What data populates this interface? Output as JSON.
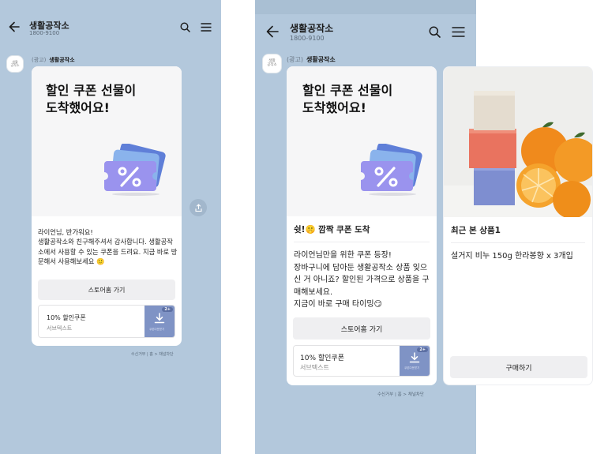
{
  "small_screen": {
    "header": {
      "title": "생활공작소",
      "subtitle": "1800-9100",
      "back_icon": "arrow-left-icon",
      "search_icon": "search-icon",
      "menu_icon": "hamburger-menu-icon"
    },
    "avatar_text": "생활\n공작소",
    "ad_label": "(광고)",
    "sender_name": "생활공작소",
    "card": {
      "title_line1": "할인 쿠폰 선물이",
      "title_line2": "도착했어요!",
      "body": "라이언님, 반가워요!\n생활공작소와 친구해주셔서 감사합니다. 생활공작소에서 사용할 수 있는 쿠폰을 드려요. 지금 바로 방문해서 사용해보세요 🙂",
      "button": "스토어홈 가기",
      "coupon_name": "10% 할인쿠폰",
      "coupon_sub": "서브텍스트",
      "coupon_badge": "2+",
      "coupon_download": "쿠폰다운받기"
    },
    "footer": "수신거부 | 홈 > 채널차단"
  },
  "large_screen": {
    "header": {
      "title": "생활공작소",
      "subtitle": "1800-9100",
      "back_icon": "arrow-left-icon",
      "search_icon": "search-icon",
      "menu_icon": "hamburger-menu-icon"
    },
    "avatar_text": "생활\n공작소",
    "ad_label": "(광고)",
    "sender_name": "생활공작소",
    "card": {
      "title_line1": "할인 쿠폰 선물이",
      "title_line2": "도착했어요!",
      "headline": "쉿!🤫 깜짝 쿠폰 도착",
      "body": "라이언님만을 위한 쿠폰 등장!\n장바구니에 담아둔 생활공작소 상품 잊으신 거 아니죠? 할인된 가격으로 상품을 구매해보세요.\n지금이 바로 구매 타이밍😏",
      "button": "스토어홈 가기",
      "coupon_name": "10% 할인쿠폰",
      "coupon_sub": "서브텍스트",
      "coupon_badge": "2+",
      "coupon_download": "쿠폰다운받기"
    },
    "product_card": {
      "headline": "최근 본 상품1",
      "body": "설거지 비누 150g 한라봉향 x 3개입",
      "button": "구매하기"
    },
    "footer": "수신거부 | 홈 > 채널차단"
  },
  "colors": {
    "chat_background": "#b3c8dc",
    "coupon_accent": "#7f93c5",
    "button_background": "#efeff1"
  }
}
